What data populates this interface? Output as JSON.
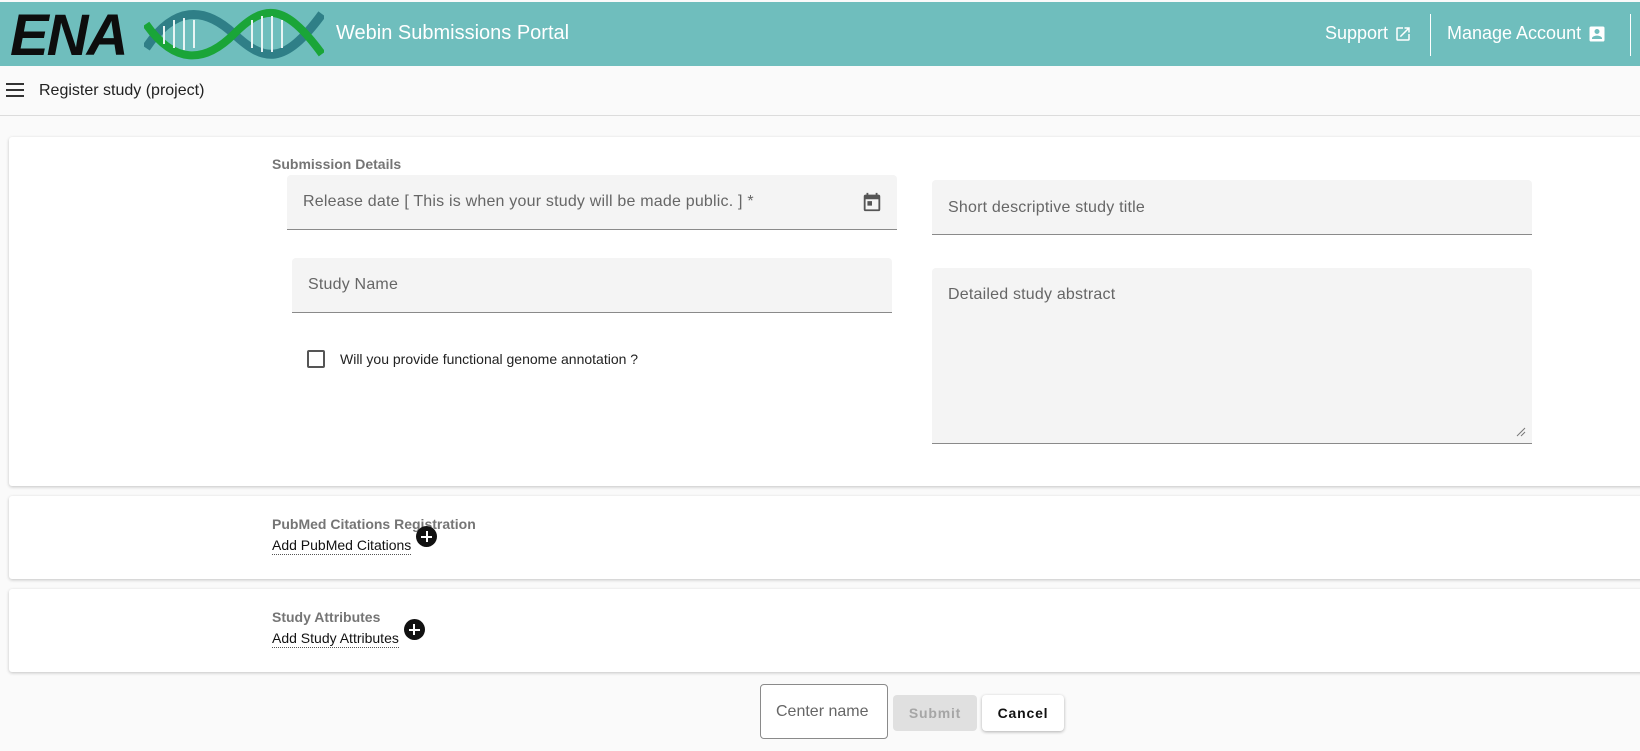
{
  "header": {
    "logo_text": "ENA",
    "portal_title": "Webin Submissions Portal",
    "support_label": "Support",
    "support_icon": "external-link-icon",
    "manage_label": "Manage Account",
    "manage_icon": "account-box-icon",
    "background_color": "#6fbebd"
  },
  "toolbar": {
    "menu_icon": "hamburger-menu-icon",
    "title": "Register study (project)"
  },
  "submission_details": {
    "section_label": "Submission Details",
    "release_date_placeholder": "Release date [ This is when your study will be made public. ] *",
    "release_date_icon": "calendar-icon",
    "study_title_placeholder": "Short descriptive study title",
    "study_name_placeholder": "Study Name",
    "study_abstract_placeholder": "Detailed study abstract",
    "annotation_checkbox_label": "Will you provide functional genome annotation ?",
    "annotation_checked": false
  },
  "pubmed": {
    "section_label": "PubMed Citations Registration",
    "add_label": "Add PubMed Citations",
    "add_icon": "add-circle-icon"
  },
  "attributes": {
    "section_label": "Study Attributes",
    "add_label": "Add Study Attributes",
    "add_icon": "add-circle-icon"
  },
  "actions": {
    "center_name_placeholder": "Center name",
    "submit_label": "Submit",
    "submit_disabled": true,
    "cancel_label": "Cancel"
  }
}
